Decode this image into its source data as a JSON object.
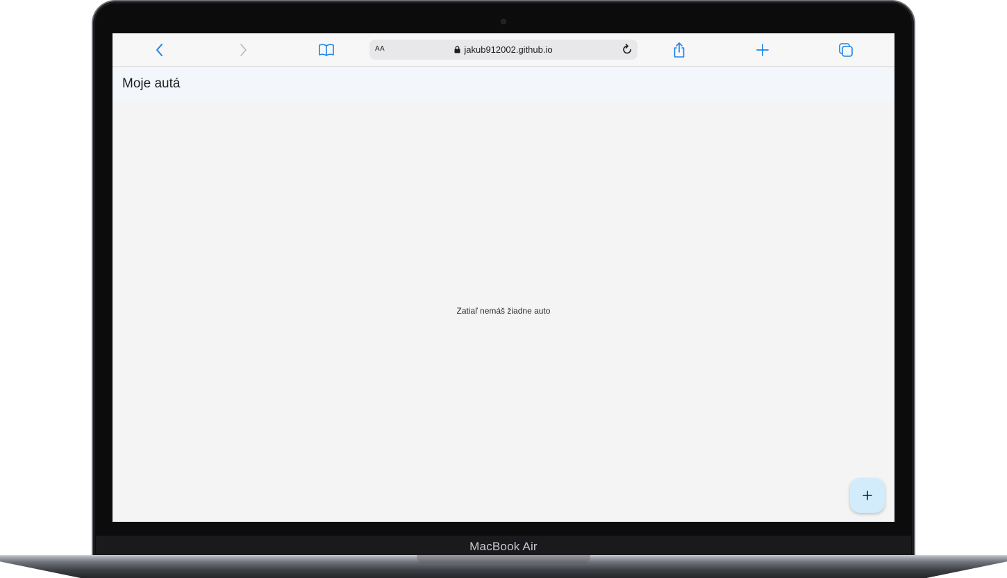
{
  "device": {
    "model_label": "MacBook Air"
  },
  "browser": {
    "reader_label": "AA",
    "url": "jakub912002.github.io",
    "icons": {
      "back": "chevron-left-icon",
      "forward": "chevron-right-icon",
      "bookmarks": "book-icon",
      "secure": "lock-icon",
      "reload": "reload-icon",
      "share": "share-icon",
      "new_tab": "plus-icon",
      "tabs": "tabs-icon"
    },
    "colors": {
      "accent": "#1a84e8",
      "disabled": "#b8b8bc"
    }
  },
  "app": {
    "title": "Moje autá",
    "empty_message": "Zatiaľ nemáš žiadne auto",
    "fab": {
      "label": "+",
      "icon": "plus-icon",
      "color": "#d3ecfb"
    }
  }
}
